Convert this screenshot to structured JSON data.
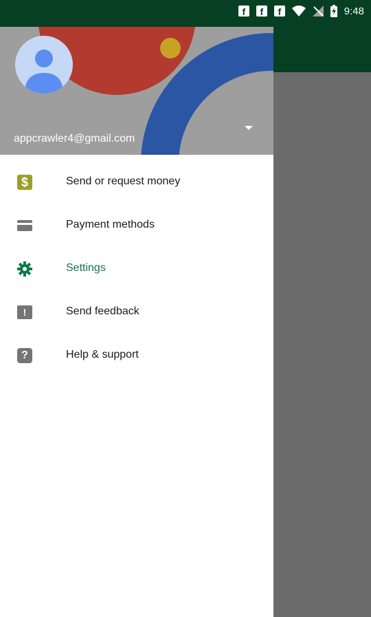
{
  "status_bar": {
    "time": "9:48",
    "icons": [
      "facebook-icon",
      "facebook-icon",
      "facebook-icon",
      "wifi-icon",
      "no-signal-icon",
      "battery-charging-icon"
    ]
  },
  "drawer": {
    "header": {
      "email": "appcrawler4@gmail.com"
    },
    "menu": [
      {
        "label": "Send or request money",
        "icon": "dollar-icon"
      },
      {
        "label": "Payment methods",
        "icon": "card-icon"
      },
      {
        "label": "Settings",
        "icon": "gear-icon",
        "color": "#0b7a4a"
      },
      {
        "label": "Send feedback",
        "icon": "feedback-icon"
      },
      {
        "label": "Help & support",
        "icon": "help-icon"
      }
    ]
  },
  "colors": {
    "primary_dark": "#063f22",
    "scrim": "#6b6b6b",
    "settings_accent": "#0b7a4a"
  }
}
